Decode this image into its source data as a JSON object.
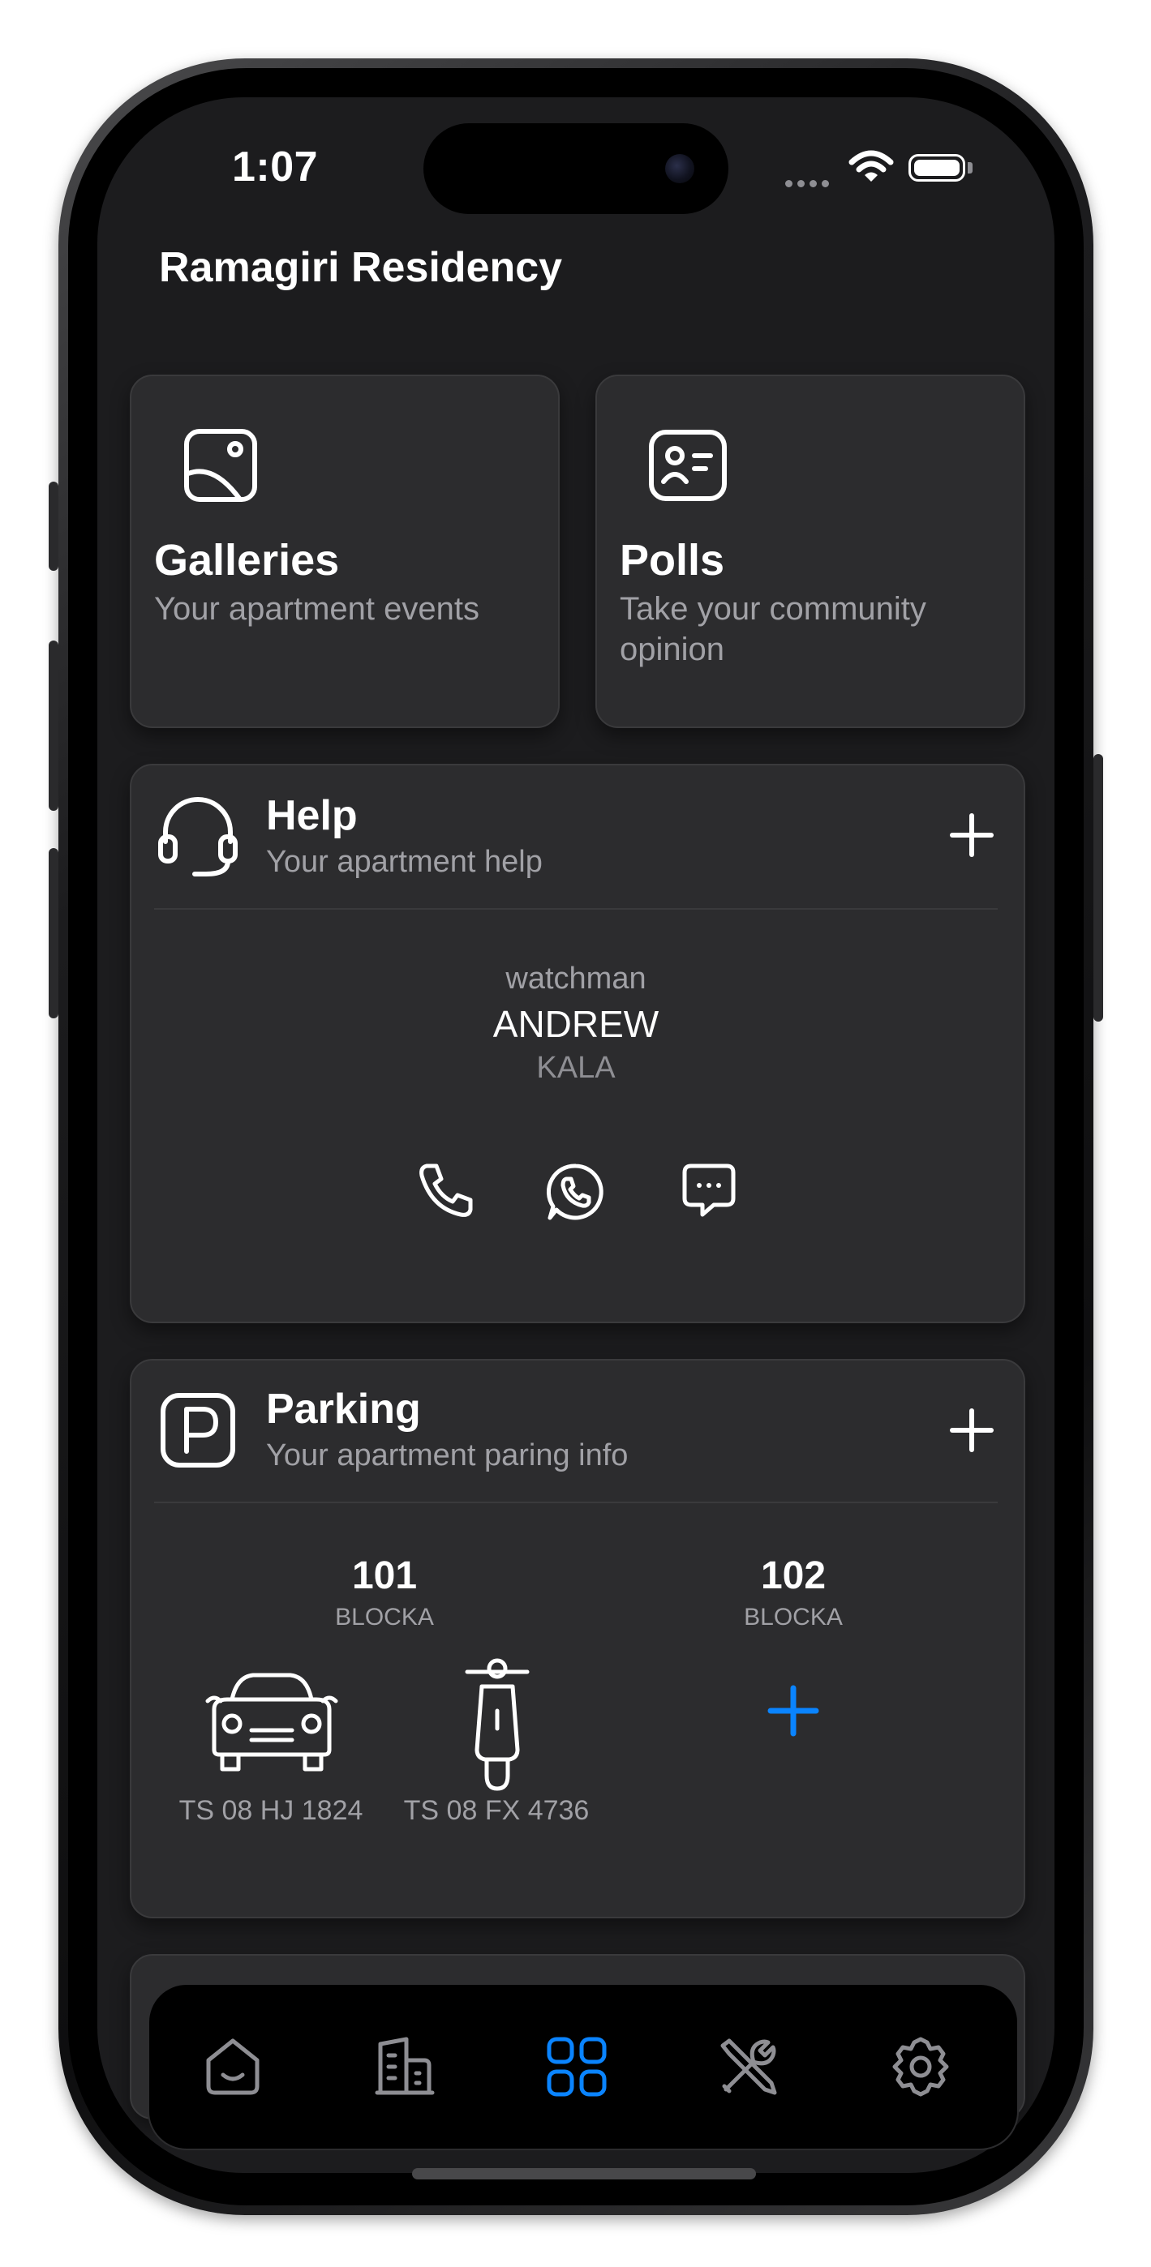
{
  "status_bar": {
    "time": "1:07"
  },
  "header": {
    "title": "Ramagiri Residency"
  },
  "tiles": [
    {
      "title": "Galleries",
      "subtitle": "Your apartment events",
      "icon": "gallery-icon"
    },
    {
      "title": "Polls",
      "subtitle_line1": "Take your community",
      "subtitle_line2": "opinion",
      "icon": "id-card-icon"
    }
  ],
  "help": {
    "title": "Help",
    "subtitle": "Your apartment help",
    "contact": {
      "role": "watchman",
      "first_name": "ANDREW",
      "last_name": "KALA"
    },
    "actions": [
      "phone-icon",
      "whatsapp-icon",
      "message-icon"
    ]
  },
  "parking": {
    "title": "Parking",
    "subtitle": "Your apartment paring info",
    "slots": [
      {
        "number": "101",
        "block": "BLOCKA",
        "vehicles": [
          {
            "type": "car-icon",
            "plate": "TS 08 HJ 1824"
          },
          {
            "type": "scooter-icon",
            "plate": "TS 08 FX 4736"
          }
        ]
      },
      {
        "number": "102",
        "block": "BLOCKA",
        "vehicles": []
      }
    ]
  },
  "tab_bar": {
    "items": [
      "home-icon",
      "building-icon",
      "grid-icon",
      "tools-icon",
      "settings-icon"
    ],
    "active": "grid-icon",
    "active_color": "#0a84ff",
    "inactive_color": "#8e8e93"
  },
  "colors": {
    "accent": "#0a84ff",
    "background": "#1c1c1e",
    "card": "#2c2c2e"
  }
}
